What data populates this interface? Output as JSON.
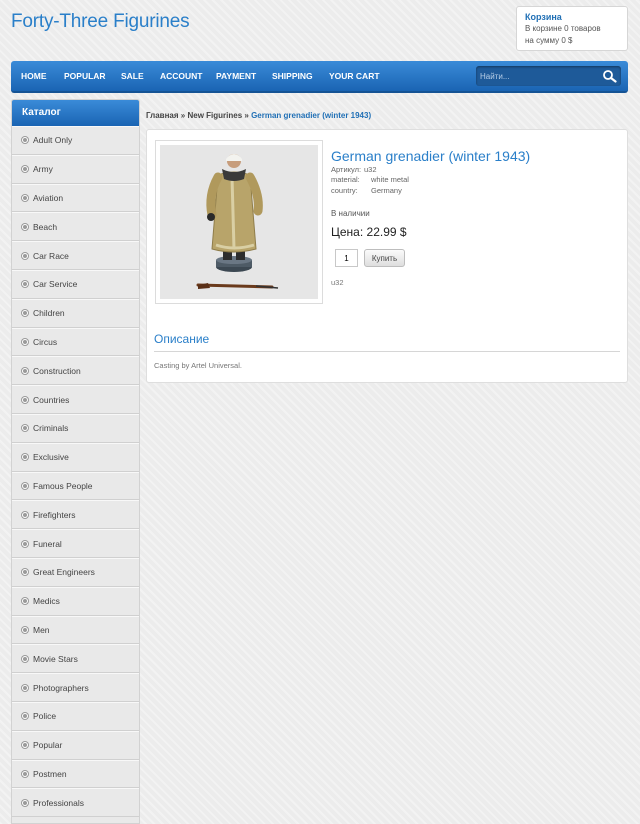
{
  "site": {
    "title": "Forty-Three Figurines"
  },
  "cart": {
    "title": "Корзина",
    "items_text": "В корзине 0 товаров",
    "sum_text": "на сумму 0 $"
  },
  "nav": {
    "items": [
      "HOME",
      "POPULAR",
      "SALE",
      "ACCOUNT",
      "PAYMENT",
      "SHIPPING",
      "YOUR CART"
    ],
    "search_placeholder": "Найти..."
  },
  "sidebar": {
    "title": "Каталог",
    "items": [
      "Adult Only",
      "Army",
      "Aviation",
      "Beach",
      "Car Race",
      "Car Service",
      "Children",
      "Circus",
      "Construction",
      "Countries",
      "Criminals",
      "Exclusive",
      "Famous People",
      "Firefighters",
      "Funeral",
      "Great Engineers",
      "Medics",
      "Men",
      "Movie Stars",
      "Photographers",
      "Police",
      "Popular",
      "Postmen",
      "Professionals"
    ]
  },
  "breadcrumb": {
    "home": "Главная",
    "sep": "»",
    "category": "New Figurines",
    "current": "German grenadier (winter 1943)"
  },
  "product": {
    "title": "German grenadier (winter 1943)",
    "sku_label": "Артикул:",
    "sku": "u32",
    "material_label": "material:",
    "material": "white metal",
    "country_label": "country:",
    "country": "Germany",
    "availability": "В наличии",
    "price": "Цена: 22.99 $",
    "quantity": "1",
    "buy_label": "Купить",
    "sku_note": "u32"
  },
  "description": {
    "title": "Описание",
    "text": "Casting by Artel Universal."
  },
  "colors": {
    "accent": "#2a7fc9",
    "nav_top": "#3a8bd8",
    "nav_bottom": "#1a64b3"
  }
}
